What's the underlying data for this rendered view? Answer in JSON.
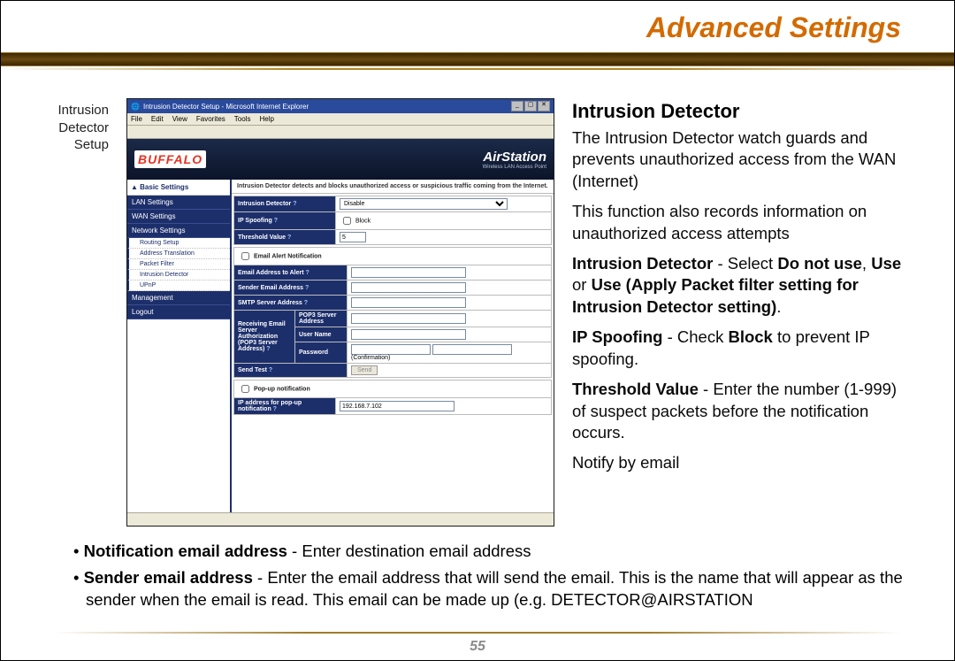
{
  "header": {
    "title": "Advanced Settings"
  },
  "caption": {
    "line1": "Intrusion",
    "line2": "Detector",
    "line3": "Setup"
  },
  "page_number": "55",
  "right": {
    "heading": "Intrusion Detector",
    "p1": "The Intrusion Detector watch guards and prevents unauthorized access from the WAN (Internet)",
    "p2": "This function also records information on unauthorized access attempts",
    "id_label": "Intrusion Detector",
    "id_mid": " - Select ",
    "id_opt1": "Do not use",
    "id_sep": ", ",
    "id_opt2": "Use",
    "id_or": " or ",
    "id_opt3": "Use (Apply Packet filter setting for Intrusion Detector setting)",
    "id_period": ".",
    "ip_label": "IP Spoofing",
    "ip_mid": " - Check ",
    "ip_bold": "Block",
    "ip_tail": " to prevent IP spoofing.",
    "th_label": "Threshold Value",
    "th_tail": " - Enter the number (1-999) of suspect packets before the notification occurs.",
    "notify": "Notify by email"
  },
  "bullets": {
    "b1_bold": "Notification email address",
    "b1_tail": " - Enter destination email address",
    "b2_bold": "Sender email address",
    "b2_tail": " - Enter the email address that will send the email.  This is the name that will appear as the sender when the email is read.  This email can be made up (e.g. DETECTOR@AIRSTATION"
  },
  "screenshot": {
    "window_title": "Intrusion Detector Setup - Microsoft Internet Explorer",
    "menus": [
      "File",
      "Edit",
      "View",
      "Favorites",
      "Tools",
      "Help"
    ],
    "brand_left": "BUFFALO",
    "brand_right": "AirStation",
    "brand_sub": "Wireless LAN Access Point",
    "nav": {
      "basic": "▲ Basic Settings",
      "items1": [
        "LAN Settings",
        "WAN Settings",
        "Network Settings"
      ],
      "subs": [
        "Routing Setup",
        "Address Translation",
        "Packet Filter",
        "Intrusion Detector",
        "UPnP"
      ],
      "items2": [
        "Management",
        "Logout"
      ]
    },
    "desc": "Intrusion Detector detects and blocks unauthorized access or suspicious traffic coming from the Internet.",
    "form": {
      "intrusion_detector": {
        "label": "Intrusion Detector",
        "value": "Disable"
      },
      "ip_spoofing": {
        "label": "IP Spoofing",
        "checkbox": "Block"
      },
      "threshold": {
        "label": "Threshold Value",
        "value": "5"
      },
      "email_alert_chk": "Email Alert Notification",
      "email_to": {
        "label": "Email Address to Alert",
        "value": ""
      },
      "sender": {
        "label": "Sender Email Address",
        "value": ""
      },
      "smtp": {
        "label": "SMTP Server Address",
        "value": ""
      },
      "recv_section": "Receiving Email Server Authorization (POP3 Server Address)",
      "pop3": {
        "label": "POP3 Server Address",
        "value": ""
      },
      "username": {
        "label": "User Name",
        "value": ""
      },
      "password": {
        "label": "Password",
        "value": "",
        "confirm": "(Confirmation)"
      },
      "send_test": {
        "label": "Send Test",
        "button": "Send"
      },
      "popup_chk": "Pop-up notification",
      "popup_ip": {
        "label": "IP address for pop-up notification",
        "value": "192.168.7.102"
      }
    }
  }
}
